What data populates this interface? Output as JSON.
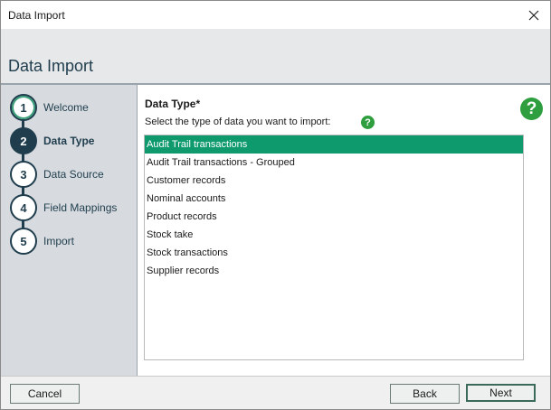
{
  "window": {
    "title": "Data Import"
  },
  "header": {
    "heading": "Data Import"
  },
  "steps": [
    {
      "number": "1",
      "label": "Welcome",
      "state": "done"
    },
    {
      "number": "2",
      "label": "Data Type",
      "state": "active"
    },
    {
      "number": "3",
      "label": "Data Source",
      "state": "pending"
    },
    {
      "number": "4",
      "label": "Field Mappings",
      "state": "pending"
    },
    {
      "number": "5",
      "label": "Import",
      "state": "pending"
    }
  ],
  "content": {
    "section_title": "Data Type*",
    "prompt": "Select the type of data you want to import:",
    "help_glyph": "?",
    "items": [
      "Audit Trail transactions",
      "Audit Trail transactions - Grouped",
      "Customer records",
      "Nominal accounts",
      "Product records",
      "Stock take",
      "Stock transactions",
      "Supplier records"
    ],
    "selected_item": "Audit Trail transactions"
  },
  "footer": {
    "cancel_label": "Cancel",
    "back_label": "Back",
    "next_label": "Next"
  },
  "colors": {
    "accent": "#0e9a6d",
    "navy": "#1f3d4d",
    "help_green": "#2e9e3e"
  }
}
